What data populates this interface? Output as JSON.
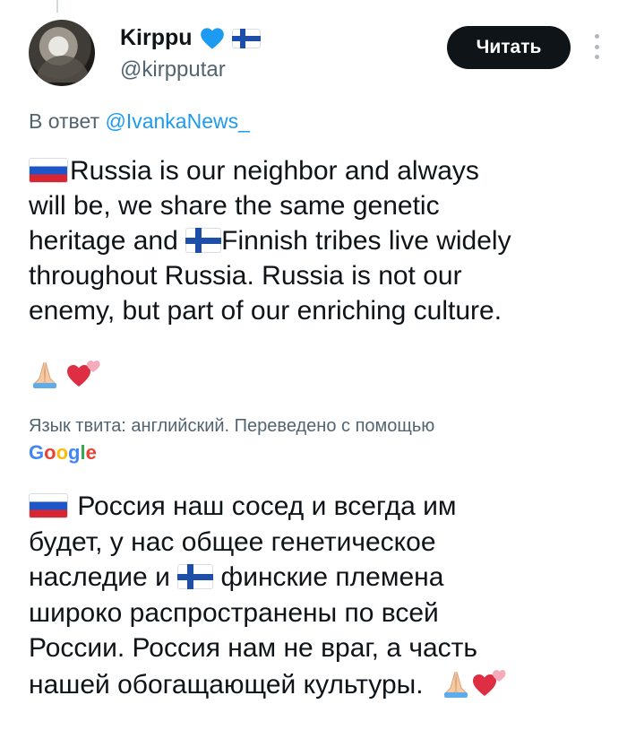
{
  "author": {
    "name": "Kirppu",
    "handle": "@kirpputar"
  },
  "follow_button": {
    "label": "Читать"
  },
  "reply": {
    "prefix": "В ответ",
    "mention": "@IvankaNews_"
  },
  "tweet": {
    "emoji": [
      "russia-flag",
      "finland-flag",
      "folded-hands",
      "two-hearts"
    ],
    "line1": "Russia is our neighbor and always",
    "line2": "will be, we share the same genetic",
    "line3a": "heritage and ",
    "line3b": "Finnish tribes live widely",
    "line4": "throughout Russia. Russia is not our",
    "line5": "enemy, but part of our enriching culture."
  },
  "translation": {
    "note": "Язык твита: английский. Переведено с помощью",
    "provider": "Google",
    "line1": " Россия наш сосед и всегда им",
    "line2": "будет, у нас общее генетическое",
    "line3a": "наследие и ",
    "line3b": " финские племена",
    "line4": "широко распространены по всей",
    "line5": "России. Россия нам не враг, а часть",
    "line6": "нашей обогащающей культуры."
  },
  "colors": {
    "text": "#0f1419",
    "secondary": "#536471",
    "link": "#1d9bf0",
    "button": "#0f1419",
    "verified_heart": "#1d9bf0"
  }
}
